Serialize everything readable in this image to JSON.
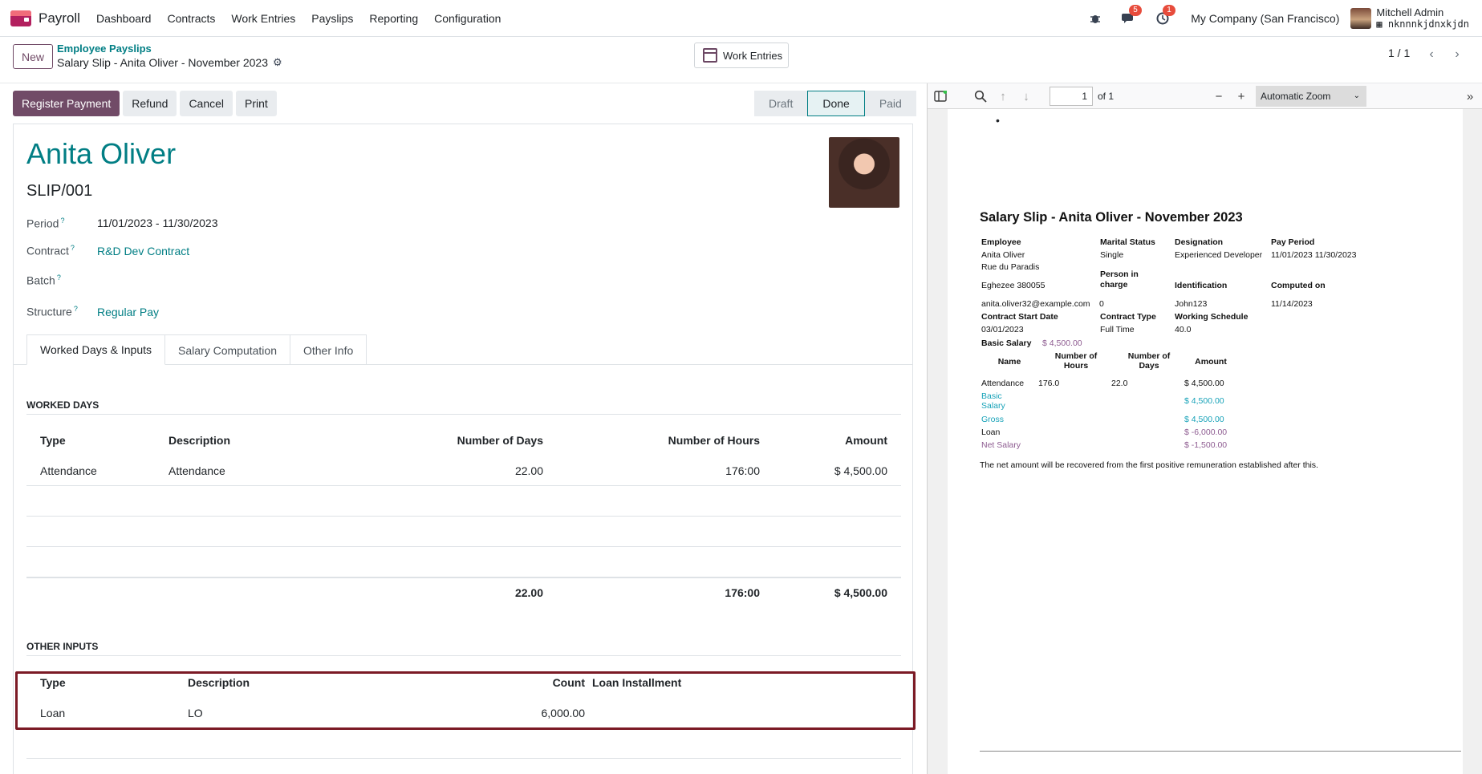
{
  "navbar": {
    "app_name": "Payroll",
    "menu": [
      "Dashboard",
      "Contracts",
      "Work Entries",
      "Payslips",
      "Reporting",
      "Configuration"
    ],
    "messages_badge": "5",
    "activities_badge": "1",
    "company": "My Company (San Francisco)",
    "user_name": "Mitchell Admin",
    "user_db": "nknnnkjdnxkjdn"
  },
  "control": {
    "new_label": "New",
    "breadcrumb_parent": "Employee Payslips",
    "breadcrumb_current": "Salary Slip - Anita Oliver - November 2023",
    "work_entries_label": "Work Entries",
    "pager": "1 / 1"
  },
  "actions": {
    "register_payment": "Register Payment",
    "refund": "Refund",
    "cancel": "Cancel",
    "print": "Print"
  },
  "status": {
    "draft": "Draft",
    "done": "Done",
    "paid": "Paid"
  },
  "form": {
    "employee_name": "Anita Oliver",
    "slip_number": "SLIP/001",
    "period_label": "Period",
    "period_value": "11/01/2023 - 11/30/2023",
    "contract_label": "Contract",
    "contract_value": "R&D Dev Contract",
    "batch_label": "Batch",
    "structure_label": "Structure",
    "structure_value": "Regular Pay",
    "help_mark": "?"
  },
  "tabs": [
    "Worked Days & Inputs",
    "Salary Computation",
    "Other Info"
  ],
  "worked_days": {
    "title": "WORKED DAYS",
    "headers": [
      "Type",
      "Description",
      "Number of Days",
      "Number of Hours",
      "Amount"
    ],
    "row": [
      "Attendance",
      "Attendance",
      "22.00",
      "176:00",
      "$ 4,500.00"
    ],
    "totals": [
      "22.00",
      "176:00",
      "$ 4,500.00"
    ]
  },
  "other_inputs": {
    "title": "OTHER INPUTS",
    "headers": [
      "Type",
      "Description",
      "Count",
      "Loan Installment"
    ],
    "row": [
      "Loan",
      "LO",
      "6,000.00"
    ]
  },
  "pdf": {
    "page_number": "1",
    "page_of": "of 1",
    "zoom": "Automatic Zoom",
    "bullet": "•",
    "title": "Salary Slip - Anita Oliver - November 2023",
    "employee_label": "Employee",
    "employee_name": "Anita Oliver",
    "address1": "Rue du Paradis",
    "address2": "Eghezee 380055",
    "email": "anita.oliver32@example.com",
    "marital_label": "Marital Status",
    "marital_value": "Single",
    "person_charge_label1": "Person in",
    "person_charge_label2": "charge",
    "person_charge_value": "0",
    "designation_label": "Designation",
    "designation_value": "Experienced Developer",
    "identification_label": "Identification",
    "identification_value": "John123",
    "pay_period_label": "Pay Period",
    "pay_period_value": "11/01/2023 11/30/2023",
    "computed_label": "Computed on",
    "computed_value": "11/14/2023",
    "contract_start_label": "Contract Start Date",
    "contract_start_value": "03/01/2023",
    "contract_type_label": "Contract Type",
    "contract_type_value": "Full Time",
    "schedule_label": "Working Schedule",
    "schedule_value": "40.0",
    "basic_salary_label": "Basic Salary",
    "basic_salary_value": "$ 4,500.00",
    "wd_headers": [
      "Name",
      "Number of",
      "Hours",
      "Number of",
      "Days",
      "Amount"
    ],
    "wd_row": [
      "Attendance",
      "176.0",
      "22.0",
      "$ 4,500.00"
    ],
    "lines": [
      {
        "name1": "Basic",
        "name2": "Salary",
        "amount": "$ 4,500.00"
      },
      {
        "name1": "Gross",
        "name2": "",
        "amount": "$ 4,500.00"
      },
      {
        "name1": "Loan",
        "name2": "",
        "amount": "$ -6,000.00"
      },
      {
        "name1": "Net Salary",
        "name2": "",
        "amount": "$ -1,500.00"
      }
    ],
    "footer_note": "The net amount will be recovered from the first positive remuneration established after this."
  }
}
